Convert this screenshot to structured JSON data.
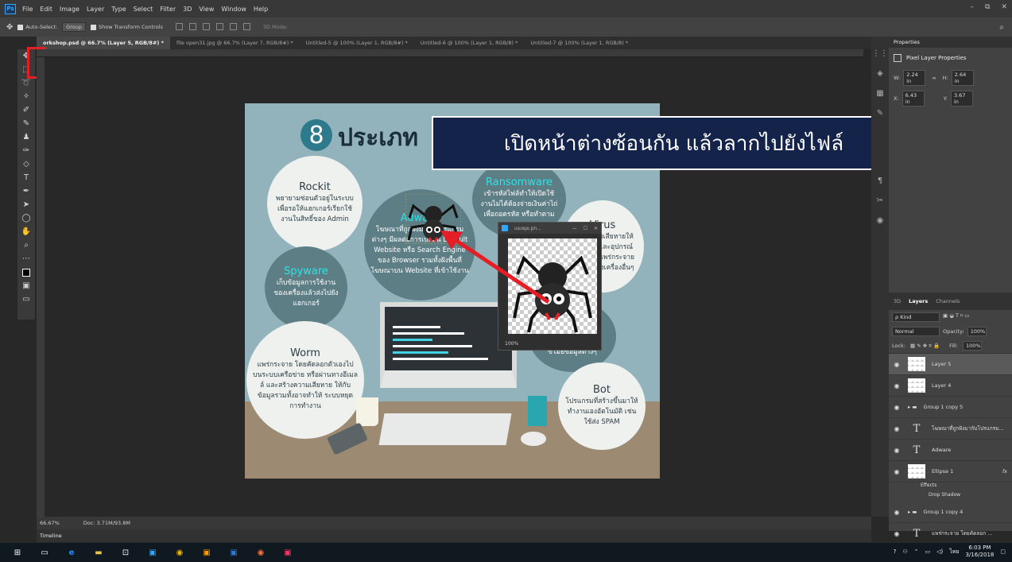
{
  "menubar": {
    "logo": "Ps",
    "items": [
      "File",
      "Edit",
      "Image",
      "Layer",
      "Type",
      "Select",
      "Filter",
      "3D",
      "View",
      "Window",
      "Help"
    ],
    "window_controls": [
      "–",
      "⧉",
      "✕"
    ]
  },
  "options": {
    "auto_select": "Auto-Select:",
    "group_dropdown": "Group",
    "show_transform": "Show Transform Controls",
    "mode_3d": "3D Mode:"
  },
  "tabs": [
    {
      "label": "orkshop.psd @ 66.7% (Layer 5, RGB/8#) *",
      "active": true
    },
    {
      "label": "file open31.jpg @ 66.7% (Layer 7, RGB/8#) *",
      "active": false
    },
    {
      "label": "Untitled-5 @ 100% (Layer 1, RGB/8#) *",
      "active": false
    },
    {
      "label": "Untitled-6 @ 100% (Layer 1, RGB/8) *",
      "active": false
    },
    {
      "label": "Untitled-7 @ 100% (Layer 1, RGB/8) *",
      "active": false
    }
  ],
  "artwork": {
    "title_num": "8",
    "title_text": "ประเภท",
    "bubbles": {
      "rockit": {
        "title": "Rockit",
        "text": "พยายามซ่อนตัวอยู่ในระบบเพื่อรอให้แฮกเกอร์เรียกใช้งานในสิทธิ์ของ Admin"
      },
      "adware": {
        "title": "Adware",
        "text": "โฆษณาที่ถูกฝังมากับโปรแกรมต่างๆ มีผลต่อการเปลี่ยน Default Website หรือ Search Engine ของ Browser รวมทั้งฝังพื้นที่โฆษณาบน Website ที่เข้าใช้งาน"
      },
      "ransomware": {
        "title": "Ransomware",
        "text": "เข้ารหัสไฟล์ทำให้เปิดใช้งานไม่ได้ต้องจ่ายเงินค่าไถ่เพื่อถอดรหัส หรือทำตาม"
      },
      "virus": {
        "title": "Virus",
        "text": "สร้างความเสียหายให้กับเครื่องและอุปกรณ์ต่างๆ เพื่อแพร่กระจายตัวเองไปยังเครื่องอื่นๆ"
      },
      "spyware": {
        "title": "Spyware",
        "text": "เก็บข้อมูลการใช้งานของเครื่องแล้วส่งไปยังแฮกเกอร์"
      },
      "worm": {
        "title": "Worm",
        "text": "แพร่กระจาย โดยคัดลอกตัวเองไปบนระบบเครือข่าย หรือผ่านทางอีเมลล์ และสร้างความเสียหาย ให้กับข้อมูลรวมทั้งอาจทำให้ ระบบหยุดการทำงาน"
      },
      "trojan": {
        "title": "",
        "text": "ขโมยข้อมูลต่างๆ"
      },
      "bot": {
        "title": "Bot",
        "text": "โปรแกรมที่สร้างขึ้นมาให้ทำงานเองอัตโนมัติ เช่น ใช้ส่ง SPAM"
      }
    }
  },
  "floatwin": {
    "title": "แมงมุม.pn...",
    "zoom": "100%"
  },
  "callout": {
    "text": "เปิดหน้าต่างซ้อนกัน แล้วลากไปยังไฟล์"
  },
  "properties": {
    "header": "Properties",
    "sub": "Pixel Layer Properties",
    "w_label": "W:",
    "w": "2.24 in",
    "h_label": "H:",
    "h": "2.64 in",
    "x_label": "X:",
    "x": "6.43 in",
    "y_label": "Y:",
    "y": "3.67 in"
  },
  "layers": {
    "tabs": [
      "3D",
      "Layers",
      "Channels"
    ],
    "kind": "ρ Kind",
    "blend": "Normal",
    "opacity_label": "Opacity:",
    "opacity": "100%",
    "lock_label": "Lock:",
    "fill_label": "Fill:",
    "fill": "100%",
    "rows": [
      {
        "name": "Layer 5",
        "type": "pixel",
        "selected": true
      },
      {
        "name": "Layer 4",
        "type": "pixel",
        "selected": false
      },
      {
        "name": "Group 1 copy 5",
        "type": "group",
        "selected": false
      },
      {
        "name": "โฆษณาที่ถูกฝังมากับโปรแกรม...",
        "type": "text",
        "selected": false
      },
      {
        "name": "Adware",
        "type": "text",
        "selected": false
      },
      {
        "name": "Ellipse 1",
        "type": "shape",
        "selected": false
      },
      {
        "name": "Effects",
        "type": "effect",
        "selected": false
      },
      {
        "name": "Drop Shadow",
        "type": "effect",
        "selected": false
      },
      {
        "name": "Group 1 copy 4",
        "type": "group",
        "selected": false
      },
      {
        "name": "แพร่กระจาย โดยคัดลอก ...",
        "type": "text",
        "selected": false
      }
    ]
  },
  "status": {
    "zoom": "66.67%",
    "doc": "Doc: 3.71M/93.8M"
  },
  "timeline": {
    "label": "Timeline"
  },
  "taskbar": {
    "time": "6:03 PM",
    "date": "3/16/2018",
    "lang": "ไทย"
  }
}
